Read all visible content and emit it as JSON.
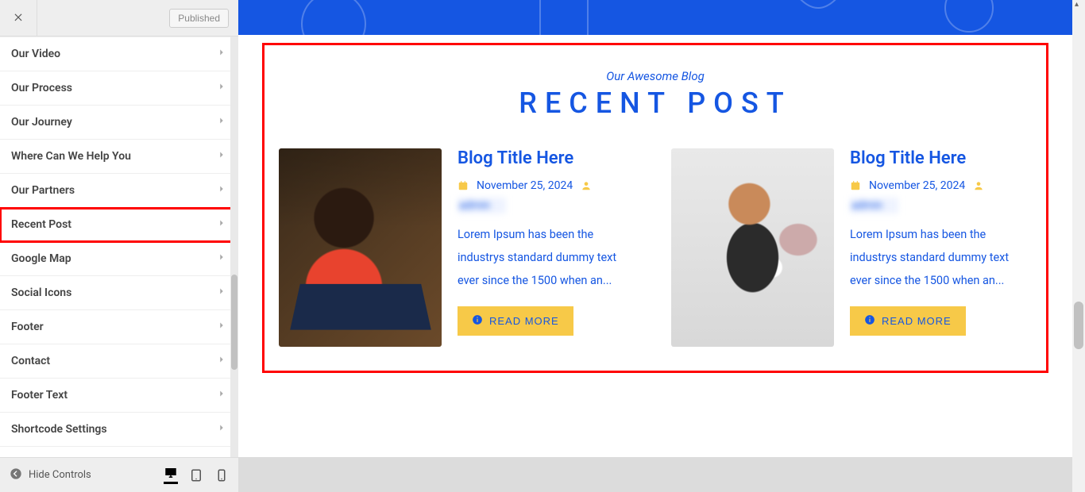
{
  "customizer": {
    "publish_label": "Published",
    "hide_controls_label": "Hide Controls",
    "items": [
      {
        "label": "Our Video"
      },
      {
        "label": "Our Process"
      },
      {
        "label": "Our Journey"
      },
      {
        "label": "Where Can We Help You"
      },
      {
        "label": "Our Partners"
      },
      {
        "label": "Recent Post"
      },
      {
        "label": "Google Map"
      },
      {
        "label": "Social Icons"
      },
      {
        "label": "Footer"
      },
      {
        "label": "Contact"
      },
      {
        "label": "Footer Text"
      },
      {
        "label": "Shortcode Settings"
      }
    ],
    "highlight_index": 5
  },
  "preview": {
    "subtitle": "Our Awesome Blog",
    "title": "RECENT POST",
    "read_more_label": "READ MORE",
    "posts": [
      {
        "title": "Blog Title Here",
        "date": "November 25, 2024",
        "author": "admin",
        "excerpt": "Lorem Ipsum has been the industrys standard dummy text ever since the 1500 when an..."
      },
      {
        "title": "Blog Title Here",
        "date": "November 25, 2024",
        "author": "admin",
        "excerpt": "Lorem Ipsum has been the industrys standard dummy text ever since the 1500 when an..."
      }
    ]
  }
}
